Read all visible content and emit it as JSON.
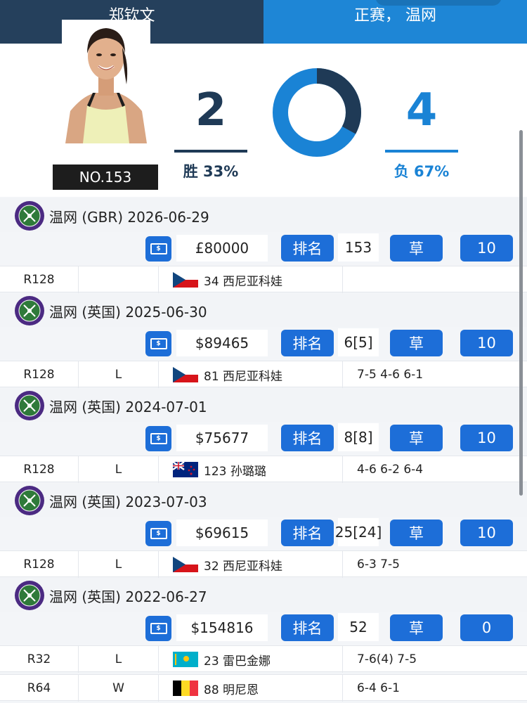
{
  "tabs": {
    "player": "郑钦文",
    "filter": "正赛， 温网"
  },
  "summary": {
    "rank_badge": "NO.153",
    "wins": "2",
    "win_label": "胜 33%",
    "losses": "4",
    "loss_label": "负 67%",
    "win_fraction": 0.33,
    "colors": {
      "win": "#1f3a56",
      "loss": "#1a83d5"
    }
  },
  "rank_label": "排名",
  "surface_label": "草",
  "money_icon": "cash-icon",
  "tournaments": [
    {
      "title": "温网 (GBR) 2026-06-29",
      "prize": "£80000",
      "seed": "153",
      "count": "10",
      "matches": [
        {
          "round": "R128",
          "result": "",
          "opponent": "34 西尼亚科娃",
          "flag": "czech-flag",
          "score": ""
        }
      ]
    },
    {
      "title": "温网 (英国) 2025-06-30",
      "prize": "$89465",
      "seed": "6[5]",
      "count": "10",
      "matches": [
        {
          "round": "R128",
          "result": "L",
          "opponent": "81 西尼亚科娃",
          "flag": "czech-flag",
          "score": "7-5 4-6 6-1"
        }
      ]
    },
    {
      "title": "温网 (英国) 2024-07-01",
      "prize": "$75677",
      "seed": "8[8]",
      "count": "10",
      "matches": [
        {
          "round": "R128",
          "result": "L",
          "opponent": "123 孙璐璐",
          "flag": "nz-flag",
          "score": "4-6 6-2 6-4"
        }
      ]
    },
    {
      "title": "温网 (英国) 2023-07-03",
      "prize": "$69615",
      "seed": "25[24]",
      "count": "10",
      "matches": [
        {
          "round": "R128",
          "result": "L",
          "opponent": "32 西尼亚科娃",
          "flag": "czech-flag",
          "score": "6-3 7-5"
        }
      ]
    },
    {
      "title": "温网 (英国) 2022-06-27",
      "prize": "$154816",
      "seed": "52",
      "count": "0",
      "matches": [
        {
          "round": "R32",
          "result": "L",
          "opponent": "23 雷巴金娜",
          "flag": "kazakhstan-flag",
          "score": "7-6(4) 7-5"
        },
        {
          "round": "R64",
          "result": "W",
          "opponent": "88 明尼恩",
          "flag": "belgium-flag",
          "score": "6-4 6-1"
        }
      ]
    }
  ]
}
